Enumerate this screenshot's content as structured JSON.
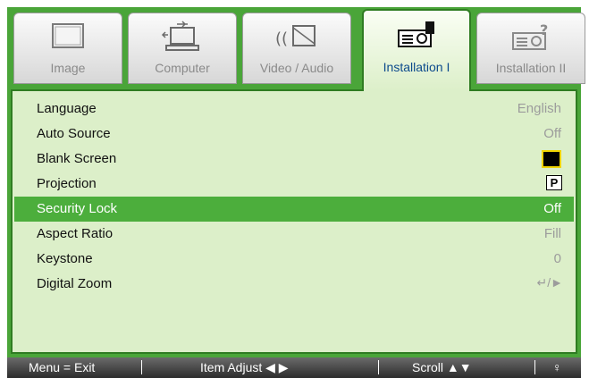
{
  "tabs": [
    {
      "label": "Image",
      "icon": "image-icon"
    },
    {
      "label": "Computer",
      "icon": "computer-icon"
    },
    {
      "label": "Video / Audio",
      "icon": "video-audio-icon"
    },
    {
      "label": "Installation I",
      "icon": "installation-i-icon",
      "active": true
    },
    {
      "label": "Installation II",
      "icon": "installation-ii-icon"
    }
  ],
  "menu": {
    "items": [
      {
        "label": "Language",
        "value": "English"
      },
      {
        "label": "Auto Source",
        "value": "Off"
      },
      {
        "label": "Blank Screen",
        "value_type": "color-swatch",
        "value_color": "#000000"
      },
      {
        "label": "Projection",
        "value": "P"
      },
      {
        "label": "Security Lock",
        "value": "Off",
        "selected": true
      },
      {
        "label": "Aspect Ratio",
        "value": "Fill"
      },
      {
        "label": "Keystone",
        "value": "0"
      },
      {
        "label": "Digital Zoom",
        "value": "↵/►"
      }
    ]
  },
  "status": {
    "menu_exit": "Menu = Exit",
    "item_adjust": "Item Adjust ◀ ▶",
    "scroll": "Scroll ▲▼",
    "help": "♀"
  },
  "colors": {
    "frame_green": "#4aa539",
    "panel_green": "#dcefc9",
    "selection_green": "#4cae3c",
    "active_tab_text": "#0c4a8c"
  }
}
